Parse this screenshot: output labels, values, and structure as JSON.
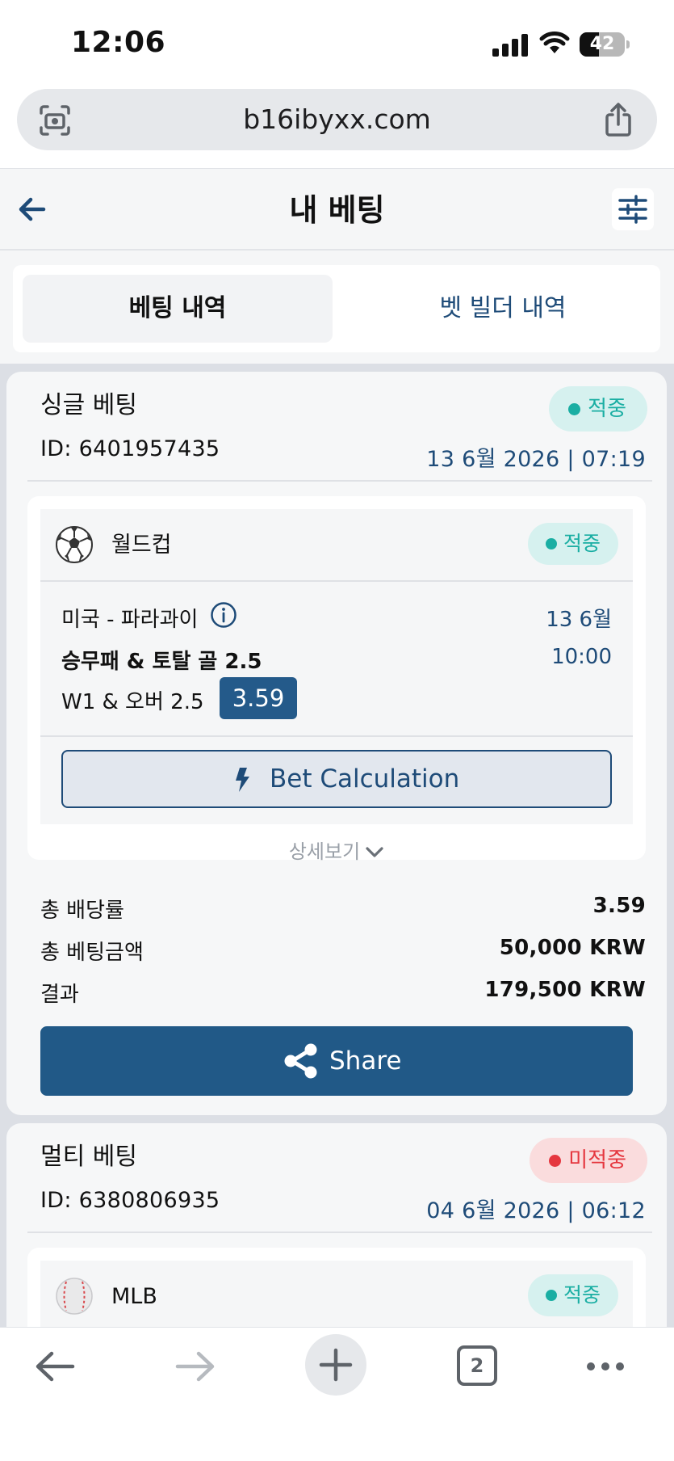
{
  "status_bar": {
    "time": "12:06",
    "battery": "42",
    "battery_level": 0.42
  },
  "browser": {
    "url": "b16ibyxx.com",
    "open_tabs": "2"
  },
  "header": {
    "title": "내 베팅"
  },
  "tabs": [
    {
      "label": "베팅 내역",
      "active": true
    },
    {
      "label": "벳 빌더 내역",
      "active": false
    }
  ],
  "bets": [
    {
      "type": "싱글 베팅",
      "status": "적중",
      "id": "ID: 6401957435",
      "date": "13 6월 2026 | 07:19",
      "event": {
        "sport_icon": "soccer-ball-icon",
        "league": "월드컵",
        "status": "적중",
        "match": "미국 - 파라과이",
        "date": "13 6월",
        "time": "10:00",
        "market": "승무패 & 토탈 골 2.5",
        "selection": "W1 & 오버 2.5",
        "odds": "3.59",
        "calc_label": "Bet Calculation"
      },
      "details_label": "상세보기",
      "summary": [
        {
          "label": "총 배당률",
          "value": "3.59"
        },
        {
          "label": "총 베팅금액",
          "value": "50,000 KRW"
        },
        {
          "label": "결과",
          "value": "179,500 KRW"
        }
      ],
      "share_label": "Share"
    },
    {
      "type": "멀티 베팅",
      "status": "미적중",
      "id": "ID: 6380806935",
      "date": "04 6월 2026 | 06:12",
      "event": {
        "sport_icon": "baseball-icon",
        "league": "MLB",
        "status": "적중"
      }
    }
  ],
  "colors": {
    "accent": "#1e4b78",
    "share_button": "#215987",
    "win": "#1aaea3",
    "lose": "#e5373f"
  }
}
